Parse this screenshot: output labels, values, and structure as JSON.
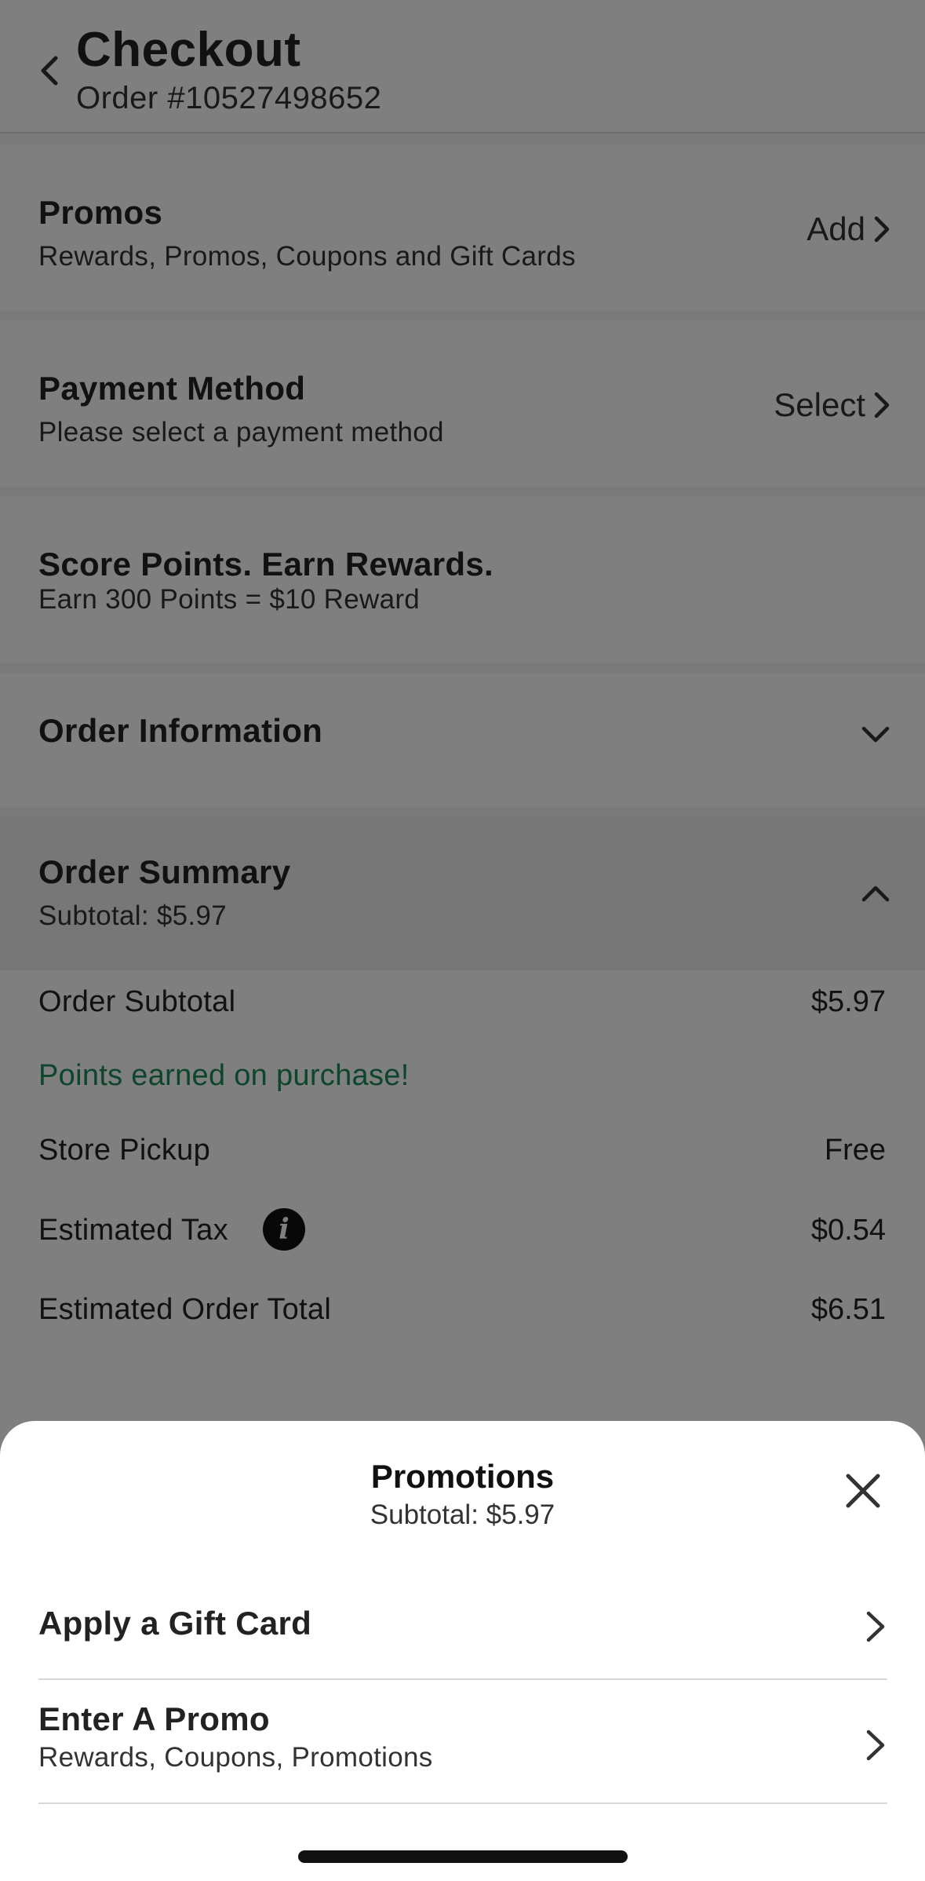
{
  "header": {
    "title": "Checkout",
    "order_number": "Order #10527498652"
  },
  "promos": {
    "title": "Promos",
    "subtitle": "Rewards, Promos, Coupons and Gift Cards",
    "action": "Add"
  },
  "payment": {
    "title": "Payment Method",
    "subtitle": "Please select a payment method",
    "action": "Select"
  },
  "rewards": {
    "title": "Score Points. Earn Rewards.",
    "subtitle": "Earn 300 Points = $10 Reward"
  },
  "order_info": {
    "title": "Order Information"
  },
  "order_summary": {
    "title": "Order Summary",
    "subtitle": "Subtotal: $5.97",
    "rows": [
      {
        "label": "Order Subtotal",
        "value": "$5.97"
      },
      {
        "label": "Points earned on purchase!"
      },
      {
        "label": "Store Pickup",
        "value": "Free"
      },
      {
        "label": "Estimated Tax",
        "value": "$0.54"
      },
      {
        "label": "Estimated Order Total",
        "value": "$6.51"
      }
    ]
  },
  "sheet": {
    "title": "Promotions",
    "subtitle": "Subtotal: $5.97",
    "items": [
      {
        "title": "Apply a Gift Card"
      },
      {
        "title": "Enter A Promo",
        "subtitle": "Rewards, Coupons, Promotions"
      }
    ]
  },
  "colors": {
    "points_green": "#1b8a5a",
    "overlay": "#000000"
  }
}
